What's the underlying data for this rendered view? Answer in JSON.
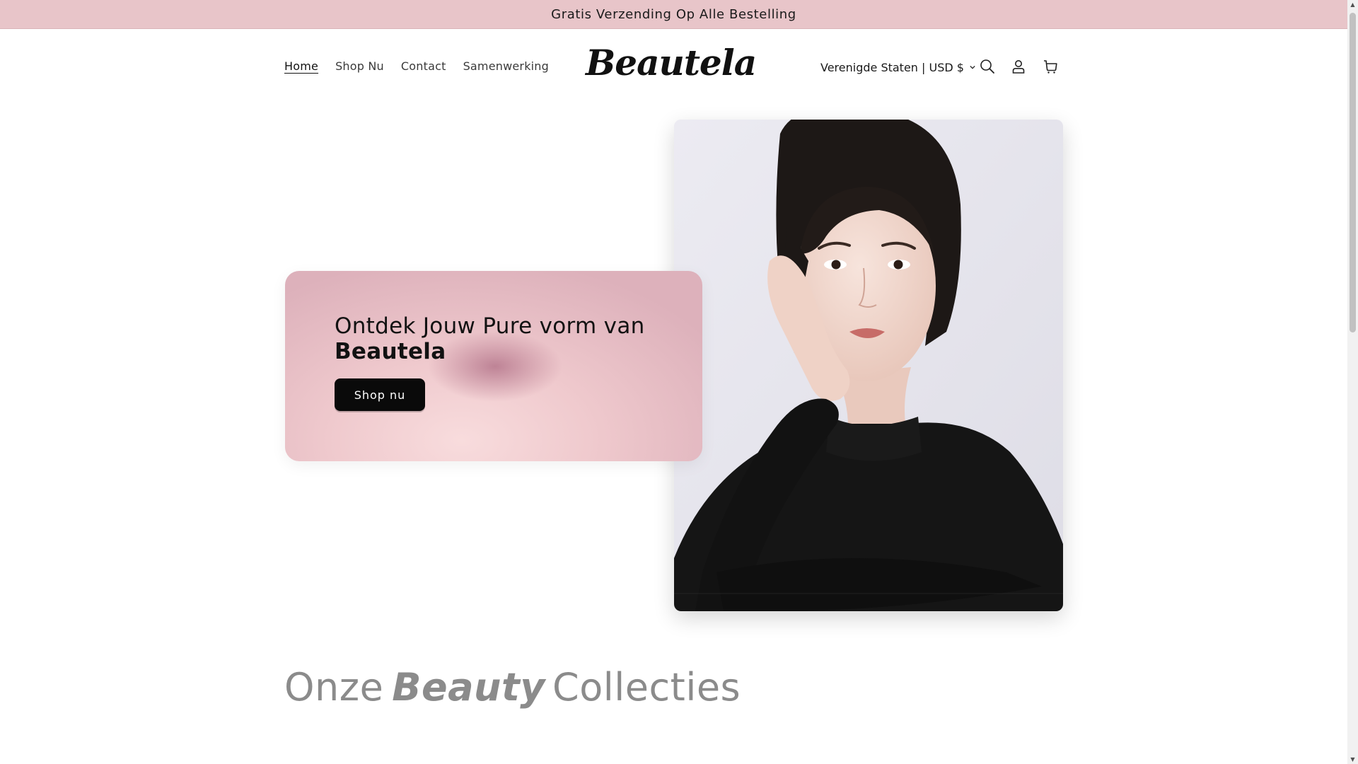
{
  "announcement": {
    "text": "Gratis Verzending Op Alle Bestelling"
  },
  "header": {
    "nav": [
      {
        "label": "Home",
        "active": true
      },
      {
        "label": "Shop Nu",
        "active": false
      },
      {
        "label": "Contact",
        "active": false
      },
      {
        "label": "Samenwerking",
        "active": false
      }
    ],
    "logo": "Beautela",
    "localization": "Verenigde Staten | USD $",
    "icons": [
      "search-icon",
      "account-icon",
      "cart-icon",
      "chevron-down-icon"
    ]
  },
  "hero": {
    "title_line1": "Ontdek Jouw Pure vorm van",
    "title_line2": "Beautela",
    "button_label": "Shop nu"
  },
  "collections": {
    "title_start": "Onze",
    "title_emphasis": "Beauty",
    "title_end": "Collecties"
  },
  "colors": {
    "announcement_bg": "#e8c5c9",
    "hero_card_bg": "#efc9cd",
    "button_bg": "#0a0a0a",
    "collections_title": "#8b8b8b"
  }
}
